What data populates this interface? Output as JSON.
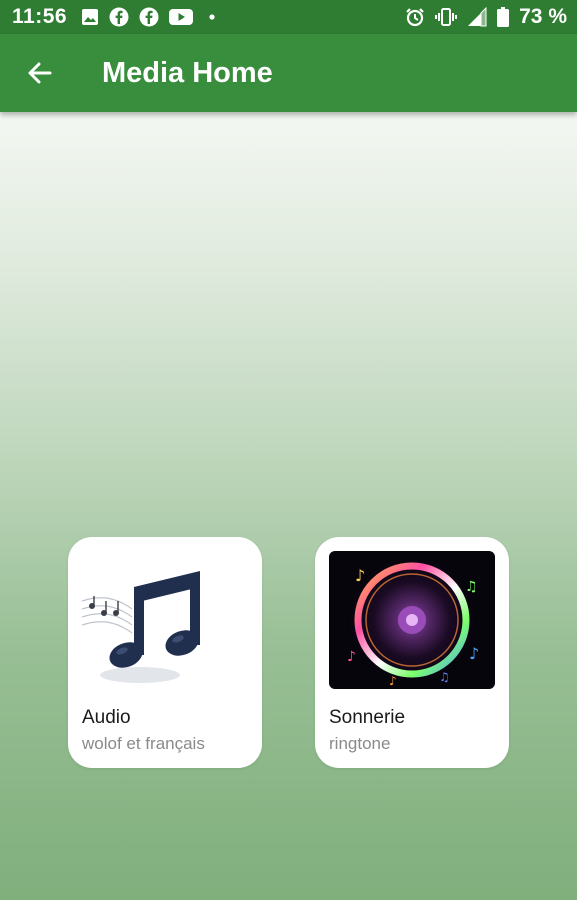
{
  "status_bar": {
    "time": "11:56",
    "left_icons": [
      "image-icon",
      "facebook-icon",
      "facebook-icon",
      "youtube-icon",
      "dot-icon"
    ],
    "right_icons": [
      "alarm-icon",
      "vibrate-icon",
      "signal-icon",
      "battery-icon"
    ],
    "battery": "73 %"
  },
  "app_bar": {
    "title": "Media Home",
    "back_icon": "arrow-left-icon"
  },
  "colors": {
    "status_bar": "#2e7d32",
    "app_bar": "#388e3c",
    "card": "#ffffff"
  },
  "cards": [
    {
      "title": "Audio",
      "subtitle": "wolof et français",
      "icon": "music-note-icon"
    },
    {
      "title": "Sonnerie",
      "subtitle": "ringtone",
      "icon": "speaker-icon"
    }
  ]
}
